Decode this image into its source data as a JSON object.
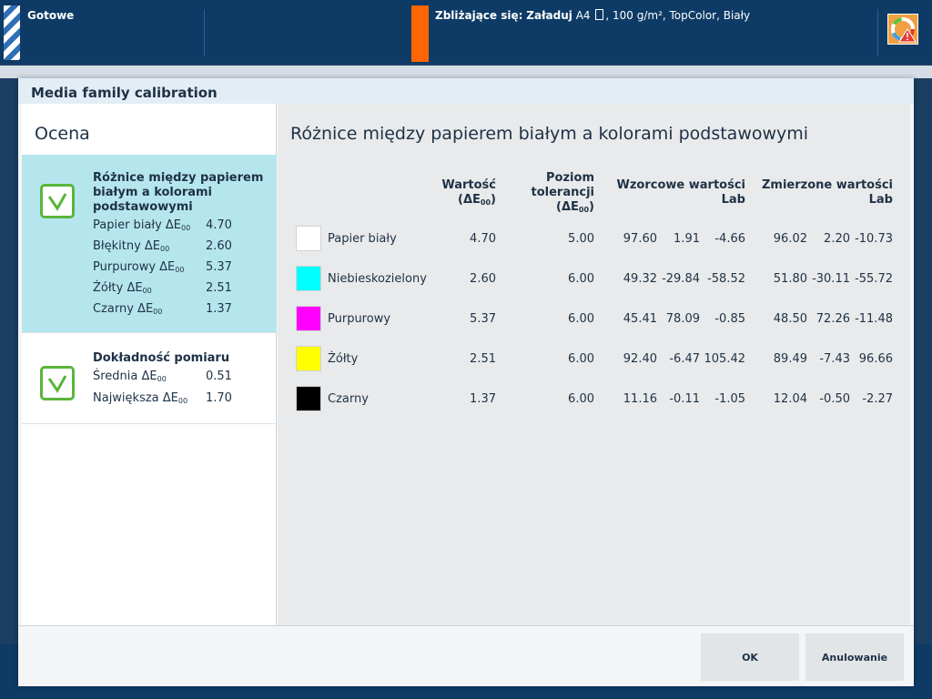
{
  "topbar": {
    "status": "Gotowe",
    "upcoming_label": "Zbliżające się:",
    "upcoming_action": "Załaduj",
    "upcoming_size": "A4",
    "upcoming_details": ", 100 g/m², TopColor, Biały"
  },
  "modal": {
    "title": "Media family calibration",
    "left_heading": "Ocena",
    "right_heading": "Różnice między papierem białym a kolorami podstawowymi",
    "ok_label": "OK",
    "cancel_label": "Anulowanie"
  },
  "cards": {
    "differences": {
      "title": "Różnice między papierem białym a kolorami podstawowymi",
      "rows": [
        {
          "label": "Papier biały ΔE",
          "value": "4.70"
        },
        {
          "label": "Błękitny ΔE",
          "value": "2.60"
        },
        {
          "label": "Purpurowy ΔE",
          "value": "5.37"
        },
        {
          "label": "Żółty ΔE",
          "value": "2.51"
        },
        {
          "label": "Czarny ΔE",
          "value": "1.37"
        }
      ]
    },
    "accuracy": {
      "title": "Dokładność pomiaru",
      "rows": [
        {
          "label": "Średnia ΔE",
          "value": "0.51"
        },
        {
          "label": "Największa ΔE",
          "value": "1.70"
        }
      ]
    },
    "subscript": "00"
  },
  "table": {
    "headers": {
      "value_line1": "Wartość",
      "value_line2": "(ΔE",
      "tolerance_line1": "Poziom",
      "tolerance_line2": "tolerancji",
      "tolerance_line3": "(ΔE",
      "reference_line1": "Wzorcowe wartości",
      "reference_line2": "Lab",
      "measured_line1": "Zmierzone wartości",
      "measured_line2": "Lab"
    },
    "rows": [
      {
        "name": "Papier biały",
        "color": "#ffffff",
        "value": "4.70",
        "tolerance": "5.00",
        "ref_l": "97.60",
        "ref_a": "1.91",
        "ref_b": "-4.66",
        "meas_l": "96.02",
        "meas_a": "2.20",
        "meas_b": "-10.73"
      },
      {
        "name": "Niebieskozielony",
        "color": "#00ffff",
        "value": "2.60",
        "tolerance": "6.00",
        "ref_l": "49.32",
        "ref_a": "-29.84",
        "ref_b": "-58.52",
        "meas_l": "51.80",
        "meas_a": "-30.11",
        "meas_b": "-55.72"
      },
      {
        "name": "Purpurowy",
        "color": "#ff00ff",
        "value": "5.37",
        "tolerance": "6.00",
        "ref_l": "45.41",
        "ref_a": "78.09",
        "ref_b": "-0.85",
        "meas_l": "48.50",
        "meas_a": "72.26",
        "meas_b": "-11.48"
      },
      {
        "name": "Żółty",
        "color": "#ffff00",
        "value": "2.51",
        "tolerance": "6.00",
        "ref_l": "92.40",
        "ref_a": "-6.47",
        "ref_b": "105.42",
        "meas_l": "89.49",
        "meas_a": "-7.43",
        "meas_b": "96.66"
      },
      {
        "name": "Czarny",
        "color": "#000000",
        "value": "1.37",
        "tolerance": "6.00",
        "ref_l": "11.16",
        "ref_a": "-0.11",
        "ref_b": "-1.05",
        "meas_l": "12.04",
        "meas_a": "-0.50",
        "meas_b": "-2.27"
      }
    ]
  },
  "colors": {
    "accent_orange": "#ff6600",
    "selected_card": "#b6e6ed",
    "check_green": "#58b63a",
    "topbar": "#0e3b66"
  },
  "icons": [
    "status-stripe-icon",
    "document-icon",
    "warning-icon",
    "checkmark-icon"
  ]
}
